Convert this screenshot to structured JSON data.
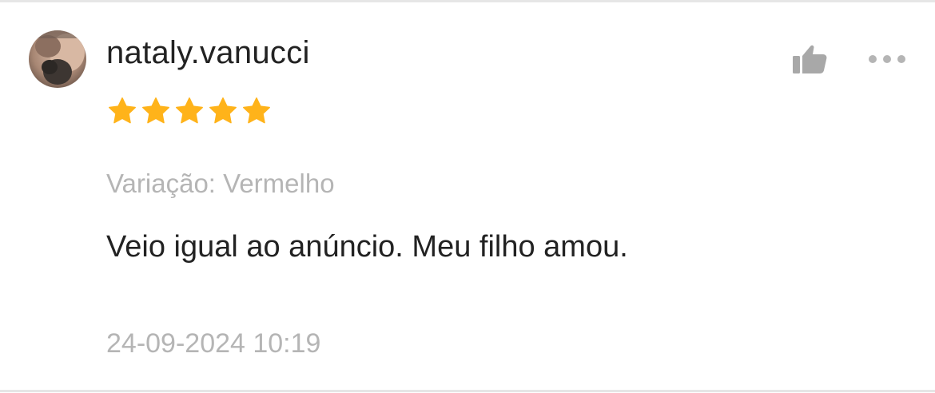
{
  "review": {
    "username": "nataly.vanucci",
    "rating": 5,
    "rating_max": 5,
    "variation": "Variação: Vermelho",
    "comment": "Veio igual ao anúncio. Meu filho amou.",
    "timestamp": "24-09-2024 10:19"
  },
  "icons": {
    "like": "thumbs-up-icon",
    "more": "more-options-icon",
    "star": "star-icon"
  },
  "colors": {
    "star": "#FFB31A",
    "primary_text": "#222222",
    "secondary_text": "#B5B5B5",
    "icon": "#A8A8A8",
    "divider": "#E6E6E6"
  }
}
